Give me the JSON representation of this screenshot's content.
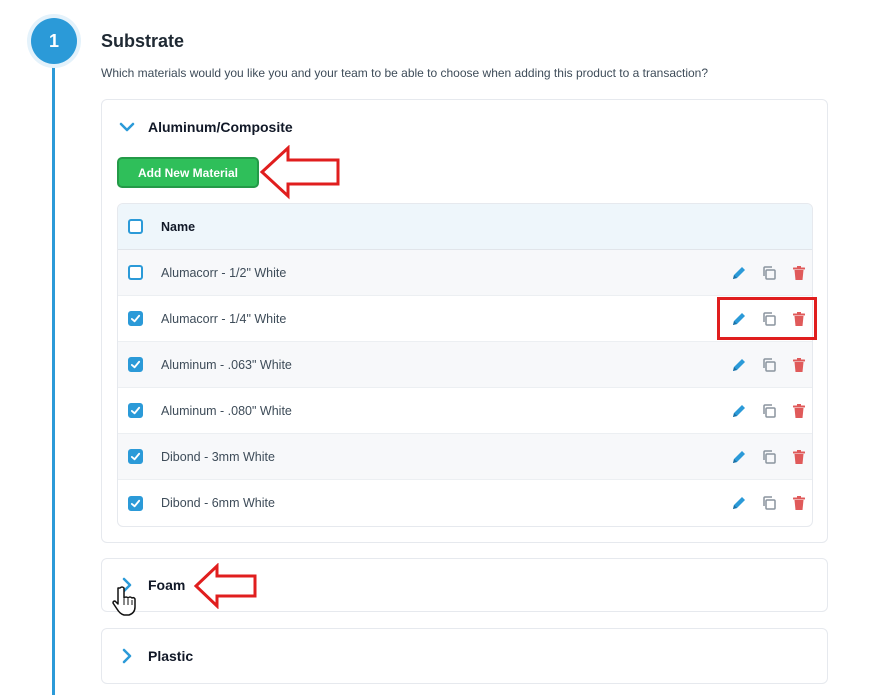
{
  "step": {
    "number": "1",
    "title": "Substrate",
    "description": "Which materials would you like you and your team to be able to choose when adding this product to a transaction?"
  },
  "groups": {
    "aluminum": {
      "label": "Aluminum/Composite",
      "expanded": true,
      "add_button_label": "Add New Material",
      "table": {
        "header": "Name",
        "rows": [
          {
            "name": "Alumacorr - 1/2\" White",
            "checked": false
          },
          {
            "name": "Alumacorr - 1/4\" White",
            "checked": true
          },
          {
            "name": "Aluminum - .063\" White",
            "checked": true
          },
          {
            "name": "Aluminum - .080\" White",
            "checked": true
          },
          {
            "name": "Dibond - 3mm White",
            "checked": true
          },
          {
            "name": "Dibond - 6mm White",
            "checked": true
          }
        ]
      }
    },
    "foam": {
      "label": "Foam",
      "expanded": false
    },
    "plastic": {
      "label": "Plastic",
      "expanded": false
    }
  },
  "icons": {
    "edit": "pencil-icon",
    "duplicate": "copy-icon",
    "delete": "trash-icon",
    "expand": "chevron-icon"
  },
  "colors": {
    "accent": "#2b9ad8",
    "add_button": "#2fbf5a",
    "delete": "#e05a5a",
    "annotation": "#e01e1e"
  }
}
